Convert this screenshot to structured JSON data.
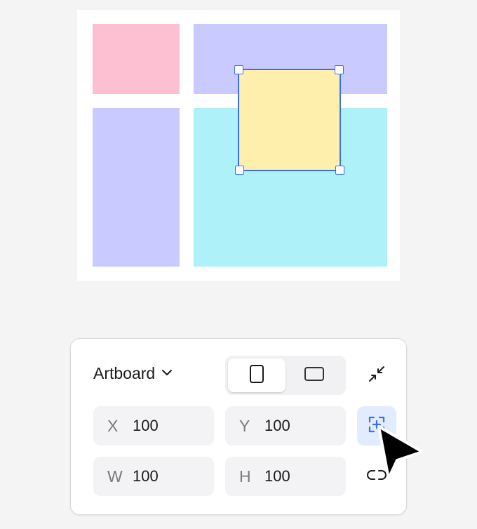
{
  "canvas": {
    "artboard_bg": "#ffffff",
    "block_colors": [
      "#fdbfd2",
      "#c9caff",
      "#c9caff",
      "#aef1f9",
      "#ffefad"
    ],
    "selection_color": "#3b6ff2"
  },
  "panel": {
    "artboard_label": "Artboard",
    "fields": {
      "x": {
        "label": "X",
        "value": "100"
      },
      "y": {
        "label": "Y",
        "value": "100"
      },
      "w": {
        "label": "W",
        "value": "100"
      },
      "h": {
        "label": "H",
        "value": "100"
      }
    },
    "orientation_selected": "portrait",
    "icons": [
      "chevron-down-icon",
      "portrait-icon",
      "landscape-icon",
      "shrink-icon",
      "fit-to-selection-icon",
      "link-icon"
    ],
    "accent_color": "#3b6ff2",
    "accent_bg": "#e3ebff"
  }
}
